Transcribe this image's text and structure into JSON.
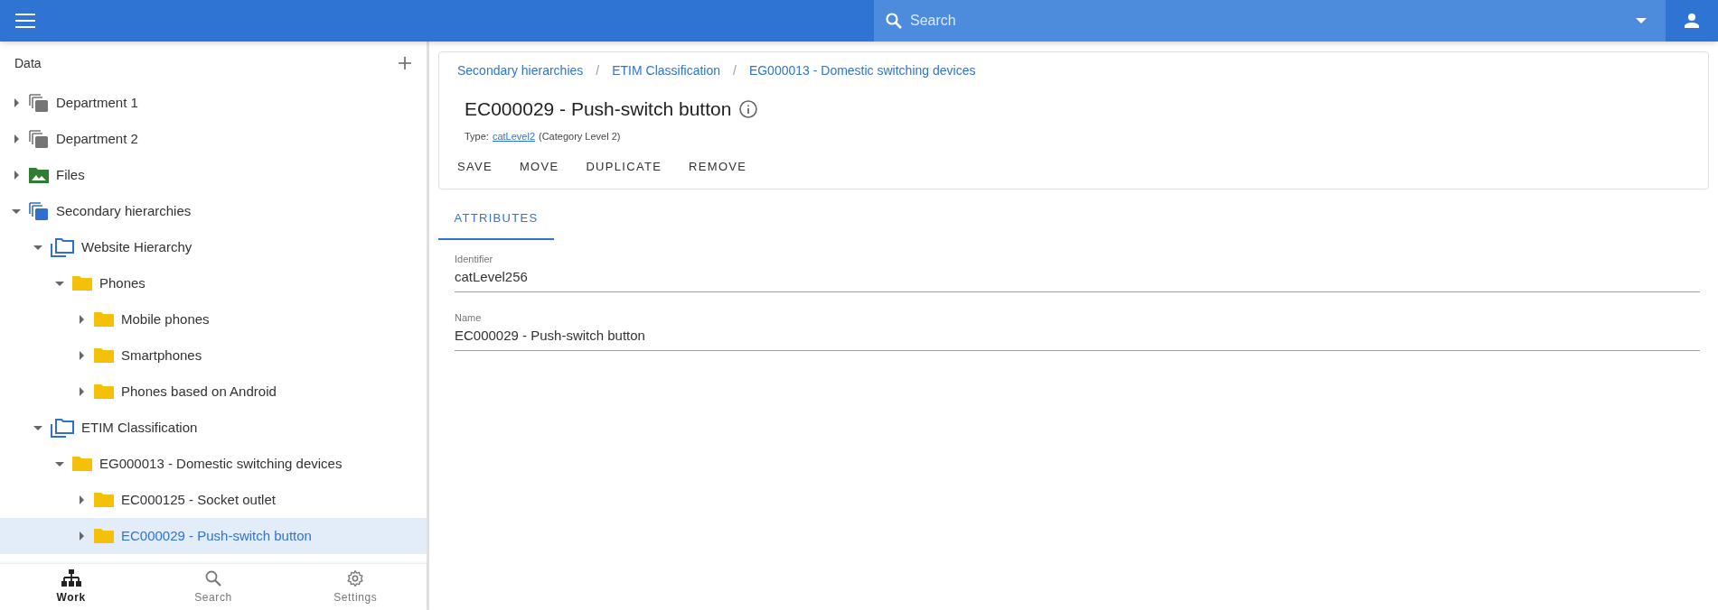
{
  "top_bar": {
    "search": {
      "placeholder": "Search"
    }
  },
  "sidebar": {
    "title": "Data",
    "tree": [
      {
        "label": "Department 1",
        "kind": "stack",
        "color": "#757575",
        "expanded": false,
        "selected": false
      },
      {
        "label": "Department 2",
        "kind": "stack",
        "color": "#757575",
        "expanded": false,
        "selected": false
      },
      {
        "label": "Files",
        "kind": "images",
        "color": "#2e7d32",
        "expanded": false,
        "selected": false
      },
      {
        "label": "Secondary hierarchies",
        "kind": "stack",
        "color": "#2f6fd1",
        "expanded": true,
        "selected": false,
        "children": [
          {
            "label": "Website Hierarchy",
            "kind": "hierarchy",
            "color": "#2f6fd1",
            "expanded": true,
            "selected": false,
            "children": [
              {
                "label": "Phones",
                "kind": "folder",
                "color": "#f5c009",
                "expanded": true,
                "selected": false,
                "children": [
                  {
                    "label": "Mobile phones",
                    "kind": "folder",
                    "color": "#f5c009",
                    "expanded": false,
                    "selected": false
                  },
                  {
                    "label": "Smartphones",
                    "kind": "folder",
                    "color": "#f5c009",
                    "expanded": false,
                    "selected": false
                  },
                  {
                    "label": "Phones based on Android",
                    "kind": "folder",
                    "color": "#f5c009",
                    "expanded": false,
                    "selected": false
                  }
                ]
              }
            ]
          },
          {
            "label": "ETIM Classification",
            "kind": "hierarchy",
            "color": "#2f6fd1",
            "expanded": true,
            "selected": false,
            "children": [
              {
                "label": "EG000013 - Domestic switching devices",
                "kind": "folder",
                "color": "#f5c009",
                "expanded": true,
                "selected": false,
                "children": [
                  {
                    "label": "EC000125 - Socket outlet",
                    "kind": "folder",
                    "color": "#f5c009",
                    "expanded": false,
                    "selected": false
                  },
                  {
                    "label": "EC000029 - Push-switch button",
                    "kind": "folder",
                    "color": "#f5c009",
                    "expanded": false,
                    "selected": true
                  }
                ]
              }
            ]
          }
        ]
      }
    ],
    "bottom_nav": [
      {
        "label": "Work",
        "kind": "hierarchy",
        "selected": true
      },
      {
        "label": "Search",
        "kind": "search",
        "selected": false
      },
      {
        "label": "Settings",
        "kind": "gear",
        "selected": false
      }
    ]
  },
  "header": {
    "breadcrumbs": [
      "Secondary hierarchies",
      "ETIM Classification",
      "EG000013 - Domestic switching devices"
    ],
    "breadcrumb_separator": "/",
    "title": "EC000029 - Push-switch button",
    "type_label": "Type:",
    "type_link": "catLevel2",
    "type_note": "(Category Level 2)",
    "actions": [
      "SAVE",
      "MOVE",
      "DUPLICATE",
      "REMOVE"
    ]
  },
  "tabs": [
    {
      "label": "ATTRIBUTES",
      "selected": true
    }
  ],
  "fields": [
    {
      "label": "Identifier",
      "value": "catLevel256"
    },
    {
      "label": "Name",
      "value": "EC000029 - Push-switch button"
    }
  ]
}
